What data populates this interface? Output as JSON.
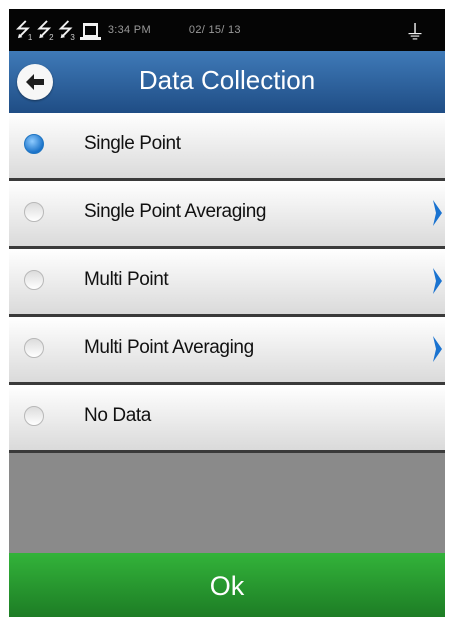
{
  "status": {
    "usb_ports": [
      "1",
      "2",
      "3"
    ],
    "time": "3:34 PM",
    "date": "02/ 15/ 13"
  },
  "header": {
    "title": "Data Collection"
  },
  "options": [
    {
      "label": "Single Point",
      "selected": true,
      "has_submenu": false
    },
    {
      "label": "Single Point Averaging",
      "selected": false,
      "has_submenu": true
    },
    {
      "label": "Multi Point",
      "selected": false,
      "has_submenu": true
    },
    {
      "label": "Multi Point Averaging",
      "selected": false,
      "has_submenu": true
    },
    {
      "label": "No Data",
      "selected": false,
      "has_submenu": false
    }
  ],
  "footer": {
    "ok_label": "Ok"
  },
  "colors": {
    "title_bar": "#2d62a0",
    "ok_bar": "#28a030",
    "radio_selected": "#1b73c9",
    "chevron": "#1a73d0"
  },
  "icons": {
    "back": "back-arrow-icon",
    "submenu": "chevron-right-icon",
    "usb": "usb-icon",
    "printer": "printer-icon",
    "probe": "probe-icon"
  }
}
